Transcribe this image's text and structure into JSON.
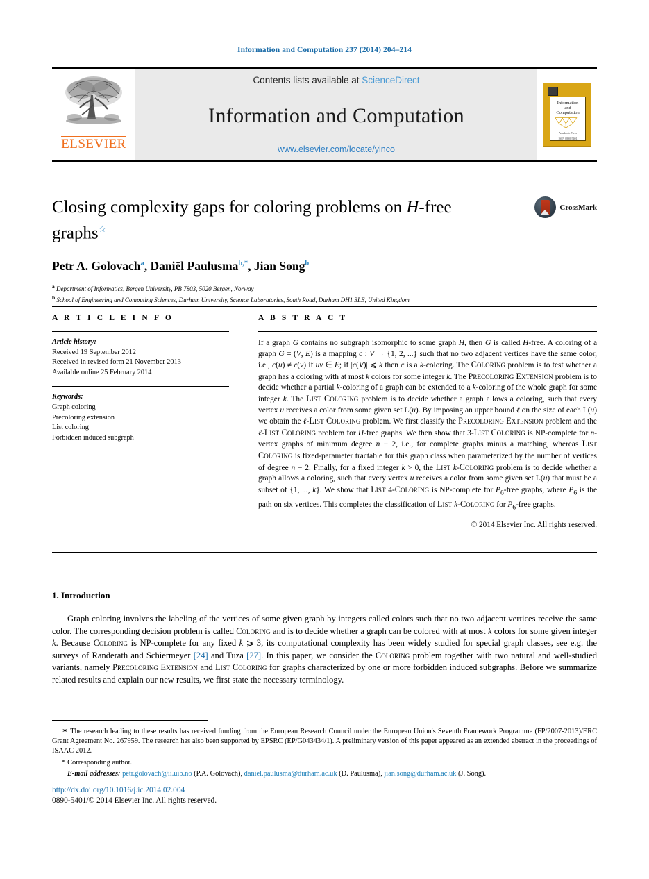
{
  "running_head": "Information and Computation 237 (2014) 204–214",
  "masthead": {
    "publisher": "ELSEVIER",
    "contents_prefix": "Contents lists available at ",
    "sciencedirect": "ScienceDirect",
    "journal_title": "Information and Computation",
    "journal_url": "www.elsevier.com/locate/yinco",
    "cover_title_line1": "Information",
    "cover_title_line2": "and",
    "cover_title_line3": "Computation",
    "cover_footer_line1": "Academic Press",
    "cover_footer_line2": "ISSN 0890-5401"
  },
  "article": {
    "title_part1": "Closing complexity gaps for coloring problems on ",
    "title_italic": "H",
    "title_part2": "-free graphs",
    "title_star": "☆",
    "crossmark_label": "CrossMark",
    "authors": [
      {
        "name": "Petr A. Golovach",
        "mark": "a"
      },
      {
        "name": "Daniël Paulusma",
        "mark": "b,*"
      },
      {
        "name": "Jian Song",
        "mark": "b"
      }
    ],
    "affiliations": [
      {
        "mark": "a",
        "text": "Department of Informatics, Bergen University, PB 7803, 5020 Bergen, Norway"
      },
      {
        "mark": "b",
        "text": "School of Engineering and Computing Sciences, Durham University, Science Laboratories, South Road, Durham DH1 3LE, United Kingdom"
      }
    ]
  },
  "info": {
    "heading": "A R T I C L E     I N F O",
    "history_label": "Article history:",
    "history": [
      "Received 19 September 2012",
      "Received in revised form 21 November 2013",
      "Available online 25 February 2014"
    ],
    "keywords_label": "Keywords:",
    "keywords": [
      "Graph coloring",
      "Precoloring extension",
      "List coloring",
      "Forbidden induced subgraph"
    ]
  },
  "abstract": {
    "heading": "A B S T R A C T",
    "copyright": "© 2014 Elsevier Inc. All rights reserved."
  },
  "introduction": {
    "heading": "1. Introduction",
    "citation_24": "[24]",
    "citation_27": "[27]"
  },
  "footnotes": {
    "star": "✶",
    "funding": "The research leading to these results has received funding from the European Research Council under the European Union's Seventh Framework Programme (FP/2007-2013)/ERC Grant Agreement No. 267959. The research has also been supported by EPSRC (EP/G043434/1). A preliminary version of this paper appeared as an extended abstract in the proceedings of ISAAC 2012.",
    "corresponding": "Corresponding author.",
    "emails_label": "E-mail addresses:",
    "emails": [
      {
        "address": "petr.golovach@ii.uib.no",
        "person": "(P.A. Golovach)"
      },
      {
        "address": "daniel.paulusma@durham.ac.uk",
        "person": "(D. Paulusma)"
      },
      {
        "address": "jian.song@durham.ac.uk",
        "person": "(J. Song)"
      }
    ]
  },
  "bottom": {
    "doi": "http://dx.doi.org/10.1016/j.ic.2014.02.004",
    "issn_line": "0890-5401/© 2014 Elsevier Inc. All rights reserved."
  },
  "colors": {
    "link_blue": "#1b6ca8",
    "sciencedirect_blue": "#4a9ad4",
    "elsevier_orange": "#f06f1e",
    "cover_gold": "#d9a616"
  }
}
